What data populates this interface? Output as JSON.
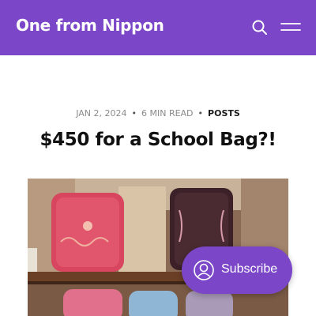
{
  "header": {
    "site_title": "One from Nippon",
    "background_color": "#7b47c8"
  },
  "post": {
    "date": "JAN 2, 2024",
    "read_time": "6 MIN READ",
    "tag": "POSTS",
    "title": "$450 for a School Bag?!"
  },
  "subscribe": {
    "label": "Subscribe",
    "icon": "wordpress-reader-icon"
  },
  "icons": {
    "search": "search-icon",
    "menu": "hamburger-menu-icon"
  }
}
